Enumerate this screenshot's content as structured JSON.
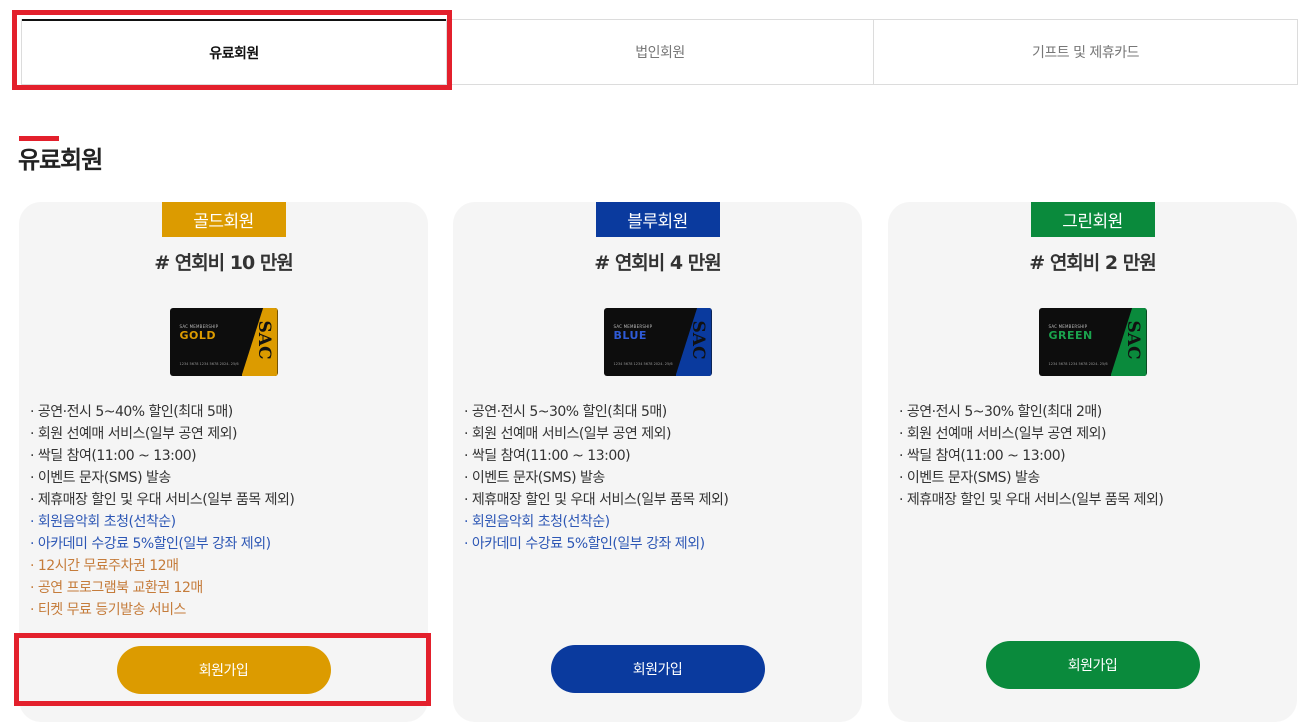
{
  "tabs": [
    {
      "label": "유료회원",
      "active": true
    },
    {
      "label": "법인회원",
      "active": false
    },
    {
      "label": "기프트 및 제휴카드",
      "active": false
    }
  ],
  "section_title": "유료회원",
  "colors": {
    "gold": "#dc9b00",
    "blue": "#0a3a9e",
    "green": "#0a8a3c",
    "highlight": "#e3202c",
    "benefit_blue": "#2d57b5",
    "benefit_orange": "#c57c3b"
  },
  "cards": [
    {
      "badge": "골드회원",
      "price": "# 연회비 10 만원",
      "card_small": "SAC MEMBERSHIP",
      "card_big": "GOLD",
      "card_sac": "SAC",
      "card_num": "1234 5678 1234 5678      2024. 25/6",
      "benefits": [
        {
          "text": "· 공연·전시 5~40% 할인(최대 5매)",
          "style": "basic"
        },
        {
          "text": "· 회원 선예매 서비스(일부 공연 제외)",
          "style": "basic"
        },
        {
          "text": "· 싹딜 참여(11:00 ~ 13:00)",
          "style": "basic"
        },
        {
          "text": "· 이벤트 문자(SMS) 발송",
          "style": "basic"
        },
        {
          "text": "· 제휴매장 할인 및 우대 서비스(일부 품목 제외)",
          "style": "basic"
        },
        {
          "text": "· 회원음악회 초청(선착순)",
          "style": "blue"
        },
        {
          "text": "· 아카데미 수강료 5%할인(일부 강좌 제외)",
          "style": "blue"
        },
        {
          "text": "· 12시간 무료주차권 12매",
          "style": "orange"
        },
        {
          "text": "· 공연 프로그램북 교환권 12매",
          "style": "orange"
        },
        {
          "text": "· 티켓 무료 등기발송 서비스",
          "style": "orange"
        }
      ],
      "button": "회원가입"
    },
    {
      "badge": "블루회원",
      "price": "# 연회비 4 만원",
      "card_small": "SAC MEMBERSHIP",
      "card_big": "BLUE",
      "card_sac": "SAC",
      "card_num": "1234 5678 1234 5678      2024. 25/6",
      "benefits": [
        {
          "text": "· 공연·전시 5~30% 할인(최대 5매)",
          "style": "basic"
        },
        {
          "text": "· 회원 선예매 서비스(일부 공연 제외)",
          "style": "basic"
        },
        {
          "text": "· 싹딜 참여(11:00 ~ 13:00)",
          "style": "basic"
        },
        {
          "text": "· 이벤트 문자(SMS) 발송",
          "style": "basic"
        },
        {
          "text": "· 제휴매장 할인 및 우대 서비스(일부 품목 제외)",
          "style": "basic"
        },
        {
          "text": "· 회원음악회 초청(선착순)",
          "style": "blue"
        },
        {
          "text": "· 아카데미 수강료 5%할인(일부 강좌 제외)",
          "style": "blue"
        }
      ],
      "button": "회원가입"
    },
    {
      "badge": "그린회원",
      "price": "# 연회비 2 만원",
      "card_small": "SAC MEMBERSHIP",
      "card_big": "GREEN",
      "card_sac": "SAC",
      "card_num": "1234 5678 1234 5678      2024. 25/6",
      "benefits": [
        {
          "text": "· 공연·전시 5~30% 할인(최대 2매)",
          "style": "basic"
        },
        {
          "text": "· 회원 선예매 서비스(일부 공연 제외)",
          "style": "basic"
        },
        {
          "text": "· 싹딜 참여(11:00 ~ 13:00)",
          "style": "basic"
        },
        {
          "text": "· 이벤트 문자(SMS) 발송",
          "style": "basic"
        },
        {
          "text": "· 제휴매장 할인 및 우대 서비스(일부 품목 제외)",
          "style": "basic"
        }
      ],
      "button": "회원가입"
    }
  ]
}
